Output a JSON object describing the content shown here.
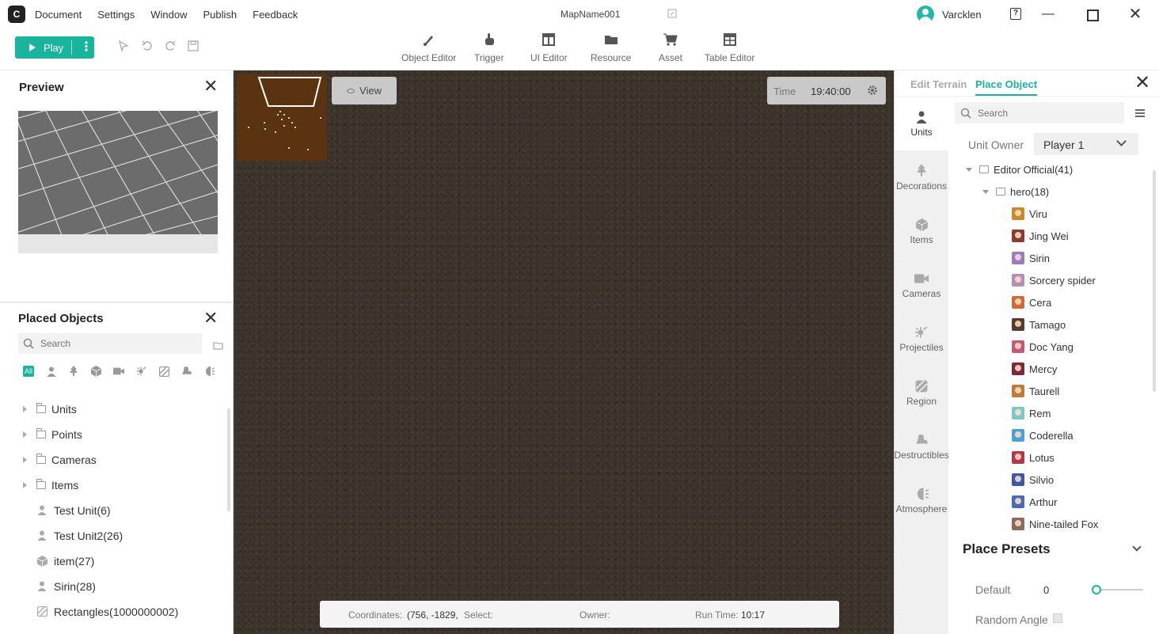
{
  "app": {
    "logo_text": "C",
    "menu": [
      "Document",
      "Settings",
      "Window",
      "Publish",
      "Feedback"
    ],
    "map_name": "MapName001",
    "user_name": "Varcklen"
  },
  "toolbar": {
    "play_label": "Play",
    "tools": [
      "Object Editor",
      "Trigger",
      "UI Editor",
      "Resource",
      "Asset",
      "Table Editor"
    ]
  },
  "preview": {
    "title": "Preview"
  },
  "placed_objects": {
    "title": "Placed Objects",
    "search_placeholder": "Search",
    "filter_all": "All",
    "folders": [
      "Units",
      "Points",
      "Cameras",
      "Items"
    ],
    "objects": [
      {
        "label": "Test Unit(6)",
        "icon": "unit-icon"
      },
      {
        "label": "Test Unit2(26)",
        "icon": "unit-icon"
      },
      {
        "label": "item(27)",
        "icon": "item-icon"
      },
      {
        "label": "Sirin(28)",
        "icon": "unit-icon"
      },
      {
        "label": "Rectangles(1000000002)",
        "icon": "region-icon"
      }
    ]
  },
  "viewport": {
    "view_label": "View",
    "time_label": "Time",
    "time_value": "19:40:00",
    "status": {
      "coordinates_label": "Coordinates:",
      "coordinates_value": "(756, -1829,",
      "select_label": "Select:",
      "owner_label": "Owner:",
      "runtime_label": "Run Time:",
      "runtime_value": "10:17"
    }
  },
  "right_panel": {
    "tab_terrain": "Edit Terrain",
    "tab_place": "Place Object",
    "search_placeholder": "Search",
    "categories": [
      "Units",
      "Decorations",
      "Items",
      "Cameras",
      "Projectiles",
      "Region",
      "Destructibles",
      "Atmosphere"
    ],
    "unit_owner_label": "Unit Owner",
    "unit_owner_value": "Player 1",
    "tree_root": "Editor Official(41)",
    "tree_sub": "hero(18)",
    "heroes": [
      {
        "name": "Viru",
        "color": "#c8892f"
      },
      {
        "name": "Jing Wei",
        "color": "#8a3b2c"
      },
      {
        "name": "Sirin",
        "color": "#9a7bc8"
      },
      {
        "name": "Sorcery spider",
        "color": "#b58fb6"
      },
      {
        "name": "Cera",
        "color": "#d06a3a"
      },
      {
        "name": "Tamago",
        "color": "#5a3a2a"
      },
      {
        "name": "Doc Yang",
        "color": "#c45a7a"
      },
      {
        "name": "Mercy",
        "color": "#7a2b3b"
      },
      {
        "name": "Taurell",
        "color": "#c07a3a"
      },
      {
        "name": "Rem",
        "color": "#7ac8c8"
      },
      {
        "name": "Coderella",
        "color": "#4aa0d8"
      },
      {
        "name": "Lotus",
        "color": "#b03a4a"
      },
      {
        "name": "Silvio",
        "color": "#3a5aa8"
      },
      {
        "name": "Arthur",
        "color": "#4a6ab8"
      },
      {
        "name": "Nine-tailed Fox",
        "color": "#8a6a5a"
      }
    ],
    "presets_title": "Place Presets",
    "preset_default_label": "Default",
    "preset_default_value": "0",
    "preset_random_label": "Random Angle"
  },
  "colors": {
    "accent": "#18b49c",
    "viewport_ground": "#3b342d",
    "minimap": "#5a3410"
  }
}
